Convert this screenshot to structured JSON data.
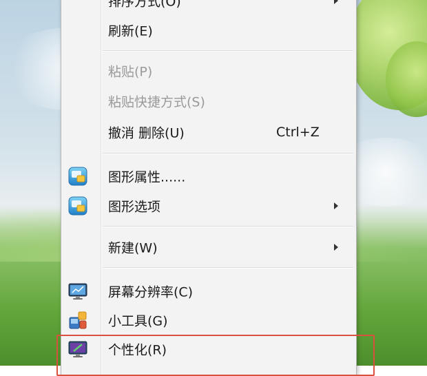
{
  "menu": {
    "items": [
      {
        "label": "排序方式(O)",
        "has_submenu": true,
        "enabled": true
      },
      {
        "label": "刷新(E)",
        "enabled": true
      },
      {
        "label": "粘贴(P)",
        "enabled": false
      },
      {
        "label": "粘贴快捷方式(S)",
        "enabled": false
      },
      {
        "label": "撤消 删除(U)",
        "shortcut": "Ctrl+Z",
        "enabled": true
      },
      {
        "label": "图形属性......",
        "icon": "graphics-properties-icon",
        "enabled": true
      },
      {
        "label": "图形选项",
        "icon": "graphics-options-icon",
        "has_submenu": true,
        "enabled": true
      },
      {
        "label": "新建(W)",
        "has_submenu": true,
        "enabled": true
      },
      {
        "label": "屏幕分辨率(C)",
        "icon": "monitor-icon",
        "enabled": true
      },
      {
        "label": "小工具(G)",
        "icon": "gadgets-icon",
        "enabled": true
      },
      {
        "label": "个性化(R)",
        "icon": "personalize-icon",
        "enabled": true,
        "highlighted": true
      }
    ]
  },
  "colors": {
    "menu_bg": "#f3f3f3",
    "disabled_text": "#9a9a9a",
    "highlight_border": "#d9503c"
  }
}
